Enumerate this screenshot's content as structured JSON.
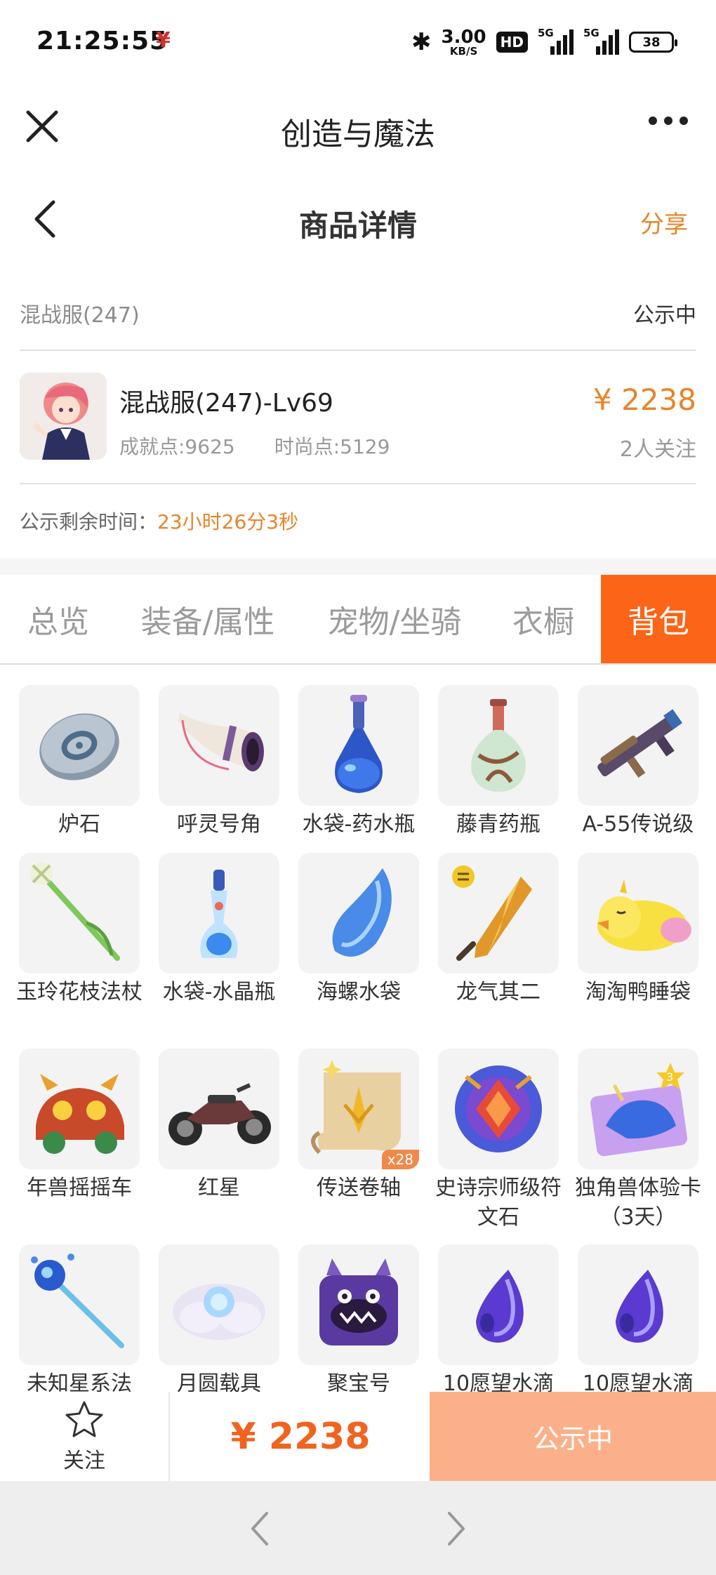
{
  "status_bar": {
    "time": "21:25:55",
    "app_badge": "¥",
    "net_speed_value": "3.00",
    "net_speed_unit": "KB/S",
    "hd": "HD",
    "signal_1": "5G",
    "signal_2": "5G",
    "battery": "38"
  },
  "app_header": {
    "title": "创造与魔法",
    "icons": [
      "close-icon",
      "more-icon"
    ]
  },
  "page_header": {
    "title": "商品详情",
    "share": "分享"
  },
  "listing": {
    "server": "混战服(247)",
    "status": "公示中",
    "char_name": "混战服(247)-Lv69",
    "achievement": "成就点:9625",
    "fashion": "时尚点:5129",
    "price": "¥ 2238",
    "followers": "2人关注",
    "remain_label": "公示剩余时间：",
    "remain_value": "23小时26分3秒"
  },
  "tabs": [
    {
      "label": "总览",
      "active": false
    },
    {
      "label": "装备/属性",
      "active": false
    },
    {
      "label": "宠物/坐骑",
      "active": false
    },
    {
      "label": "衣橱",
      "active": false
    },
    {
      "label": "背包",
      "active": true
    }
  ],
  "items": [
    {
      "name": "炉石",
      "icon": "stone-icon"
    },
    {
      "name": "呼灵号角",
      "icon": "horn-icon"
    },
    {
      "name": "水袋-药水瓶",
      "icon": "potion-bottle-icon"
    },
    {
      "name": "藤青药瓶",
      "icon": "vine-bottle-icon"
    },
    {
      "name": "A-55传说级",
      "icon": "gun-icon"
    },
    {
      "name": "玉玲花枝法杖",
      "icon": "flower-staff-icon"
    },
    {
      "name": "水袋-水晶瓶",
      "icon": "crystal-bottle-icon"
    },
    {
      "name": "海螺水袋",
      "icon": "conch-icon"
    },
    {
      "name": "龙气其二",
      "icon": "dragon-crystal-icon"
    },
    {
      "name": "淘淘鸭睡袋",
      "icon": "duck-sleeping-bag-icon"
    },
    {
      "name": "年兽摇摇车",
      "icon": "beast-cart-icon"
    },
    {
      "name": "红星",
      "icon": "motorbike-icon"
    },
    {
      "name": "传送卷轴",
      "icon": "scroll-icon",
      "badge": "x28"
    },
    {
      "name": "史诗宗师级符文石",
      "icon": "rune-stone-icon"
    },
    {
      "name": "独角兽体验卡（3天）",
      "icon": "unicorn-card-icon"
    },
    {
      "name": "未知星系法",
      "icon": "star-staff-icon"
    },
    {
      "name": "月圆载具",
      "icon": "moon-vehicle-icon"
    },
    {
      "name": "聚宝号",
      "icon": "treasure-monster-icon"
    },
    {
      "name": "10愿望水滴",
      "icon": "wish-drop-icon"
    },
    {
      "name": "10愿望水滴",
      "icon": "wish-drop-icon"
    }
  ],
  "bottom_bar": {
    "follow_label": "关注",
    "price": "¥ 2238",
    "status": "公示中"
  },
  "colors": {
    "accent": "#fc6418",
    "price": "#e8842a",
    "status_button": "#fcb08a"
  }
}
